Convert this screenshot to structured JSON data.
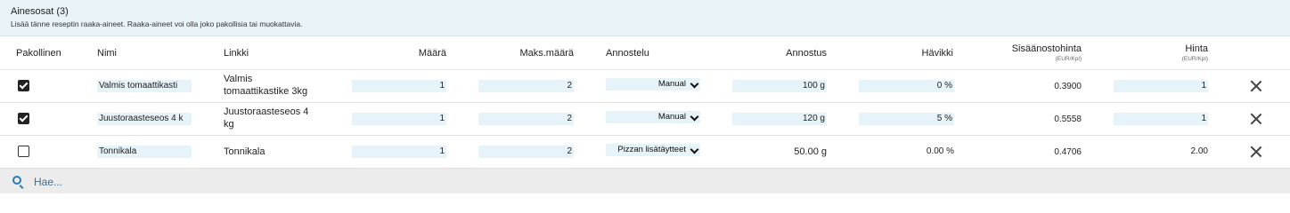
{
  "section": {
    "title": "Ainesosat (3)",
    "subtitle": "Lisää tänne reseptin raaka-aineet. Raaka-aineet voi olla joko pakollisia tai muokattavia."
  },
  "columns": {
    "pakollinen": "Pakollinen",
    "nimi": "Nimi",
    "linkki": "Linkki",
    "maara": "Määrä",
    "maks_maara": "Maks.määrä",
    "annostelu": "Annostelu",
    "annostus": "Annostus",
    "havikki": "Hävikki",
    "sisaanostohinta": "Sisäänostohinta",
    "sisaanostohinta_unit": "(EUR/Kpl)",
    "hinta": "Hinta",
    "hinta_unit": "(EUR/Kpl)"
  },
  "rows": [
    {
      "mandatory": true,
      "name": "Valmis tomaattikasti",
      "link_line1": "Valmis",
      "link_line2": "tomaattikastike 3kg",
      "amount": "1",
      "max_amount": "2",
      "dosing": "Manual",
      "portion": "100 g",
      "waste": "0 %",
      "purchase_price": "0.3900",
      "price": "1"
    },
    {
      "mandatory": true,
      "name": "Juustoraasteseos 4 k",
      "link_line1": "Juustoraasteseos 4",
      "link_line2": "kg",
      "amount": "1",
      "max_amount": "2",
      "dosing": "Manual",
      "portion": "120 g",
      "waste": "5 %",
      "purchase_price": "0.5558",
      "price": "1"
    },
    {
      "mandatory": false,
      "name": "Tonnikala",
      "link_line1": "Tonnikala",
      "link_line2": "",
      "amount": "1",
      "max_amount": "2",
      "dosing": "Pizzan lisätäytteet",
      "portion": "50.00 g",
      "waste": "0.00 %",
      "purchase_price": "0.4706",
      "price": "2.00"
    }
  ],
  "search": {
    "placeholder": "Hae..."
  }
}
